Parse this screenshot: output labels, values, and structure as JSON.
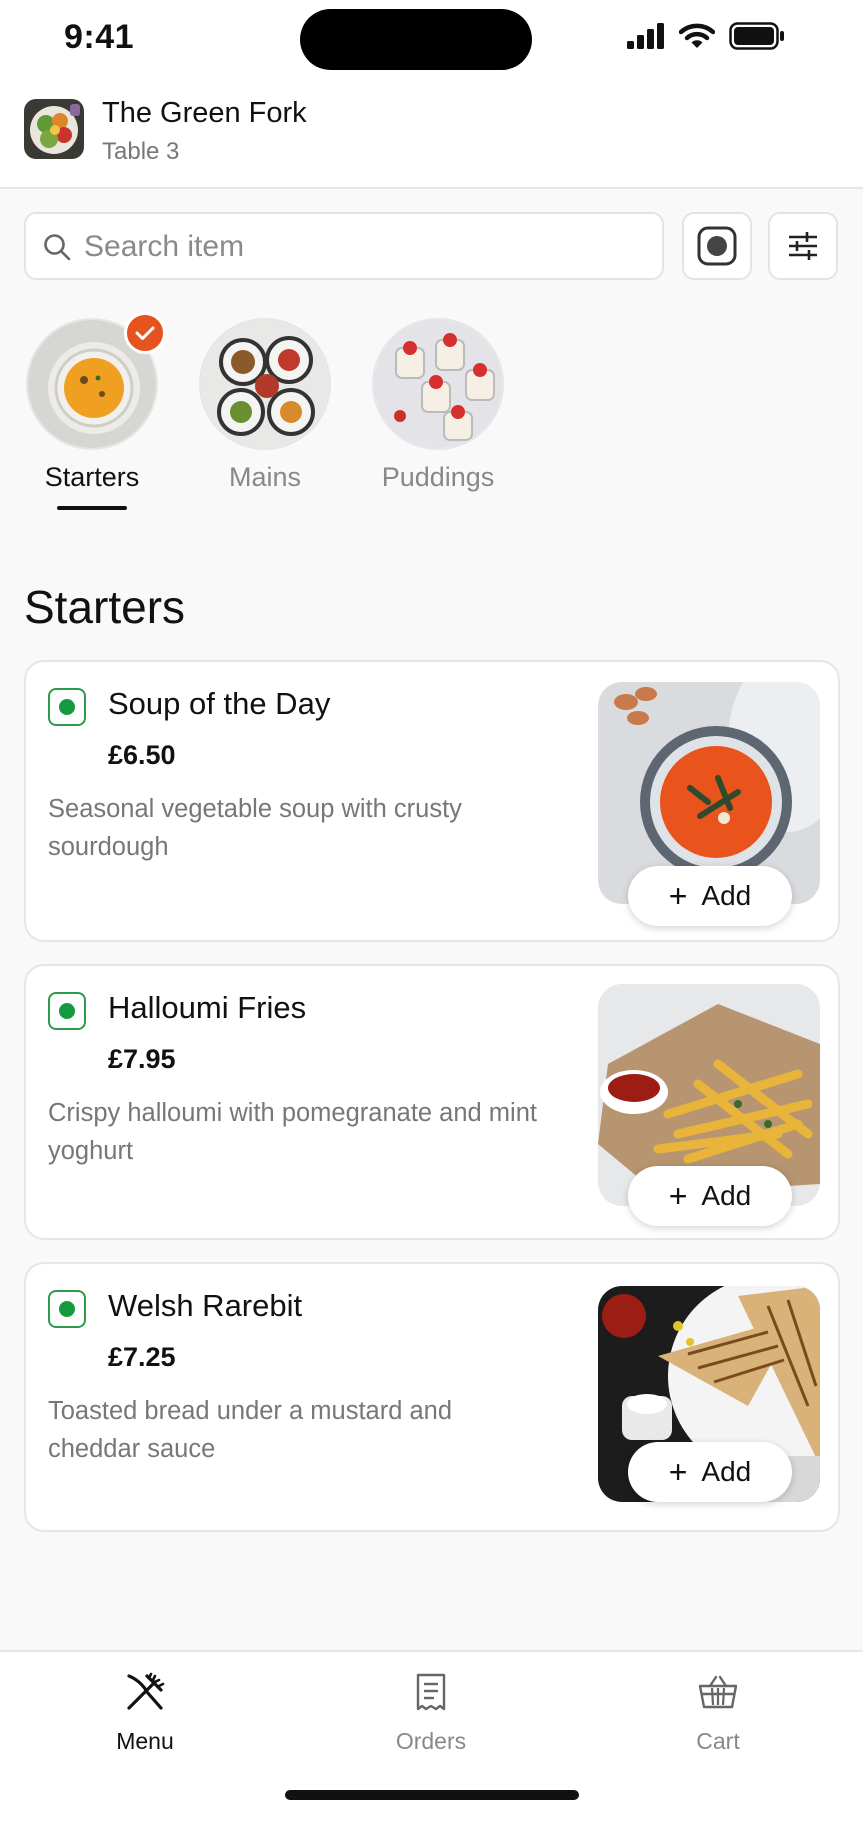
{
  "status_bar": {
    "time": "9:41"
  },
  "header": {
    "restaurant_name": "The Green Fork",
    "table_label": "Table 3"
  },
  "search": {
    "placeholder": "Search item",
    "value": ""
  },
  "categories": [
    {
      "label": "Starters",
      "selected": true
    },
    {
      "label": "Mains",
      "selected": false
    },
    {
      "label": "Puddings",
      "selected": false
    }
  ],
  "section": {
    "title": "Starters"
  },
  "items": [
    {
      "name": "Soup of the Day",
      "price": "£6.50",
      "description": "Seasonal vegetable soup with crusty sourdough",
      "add_label": "Add",
      "veg": true
    },
    {
      "name": "Halloumi Fries",
      "price": "£7.95",
      "description": "Crispy halloumi with pomegranate and mint yoghurt",
      "add_label": "Add",
      "veg": true
    },
    {
      "name": "Welsh Rarebit",
      "price": "£7.25",
      "description": "Toasted bread under a mustard and cheddar sauce",
      "add_label": "Add",
      "veg": true
    }
  ],
  "tabbar": {
    "tabs": [
      {
        "label": "Menu",
        "icon": "fork-knife-icon",
        "active": true
      },
      {
        "label": "Orders",
        "icon": "receipt-icon",
        "active": false
      },
      {
        "label": "Cart",
        "icon": "basket-icon",
        "active": false
      }
    ]
  },
  "colors": {
    "accent": "#e5531f",
    "veg_green": "#159a3d",
    "text": "#111111",
    "muted": "#777777"
  }
}
